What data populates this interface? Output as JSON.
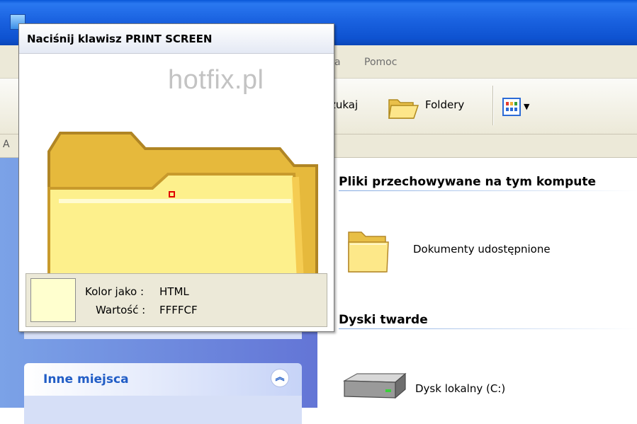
{
  "menu": {
    "items_visible": [
      "a",
      "Pomoc"
    ]
  },
  "toolbar": {
    "search_label": "zukaj",
    "folders_label": "Foldery"
  },
  "address": {
    "label_fragment": "A"
  },
  "content": {
    "group_local": "Pliki przechowywane na tym kompute",
    "shared_docs": "Dokumenty udostępnione",
    "group_drives": "Dyski twarde",
    "local_disk": "Dysk lokalny (C:)"
  },
  "taskpane": {
    "other_places": "Inne miejsca"
  },
  "magnifier": {
    "title": "Naciśnij klawisz PRINT SCREEN",
    "watermark": "hotfix.pl",
    "color_as_label": "Kolor jako :",
    "color_format": "HTML",
    "value_label": "Wartość :",
    "value": "FFFFCF",
    "swatch_color": "#FFFFCF"
  },
  "colors": {
    "title_blue": "#1a62e0",
    "taskpane_blue": "#6f8ee0",
    "link_blue": "#215dc6",
    "crosshair_red": "#e00000"
  }
}
